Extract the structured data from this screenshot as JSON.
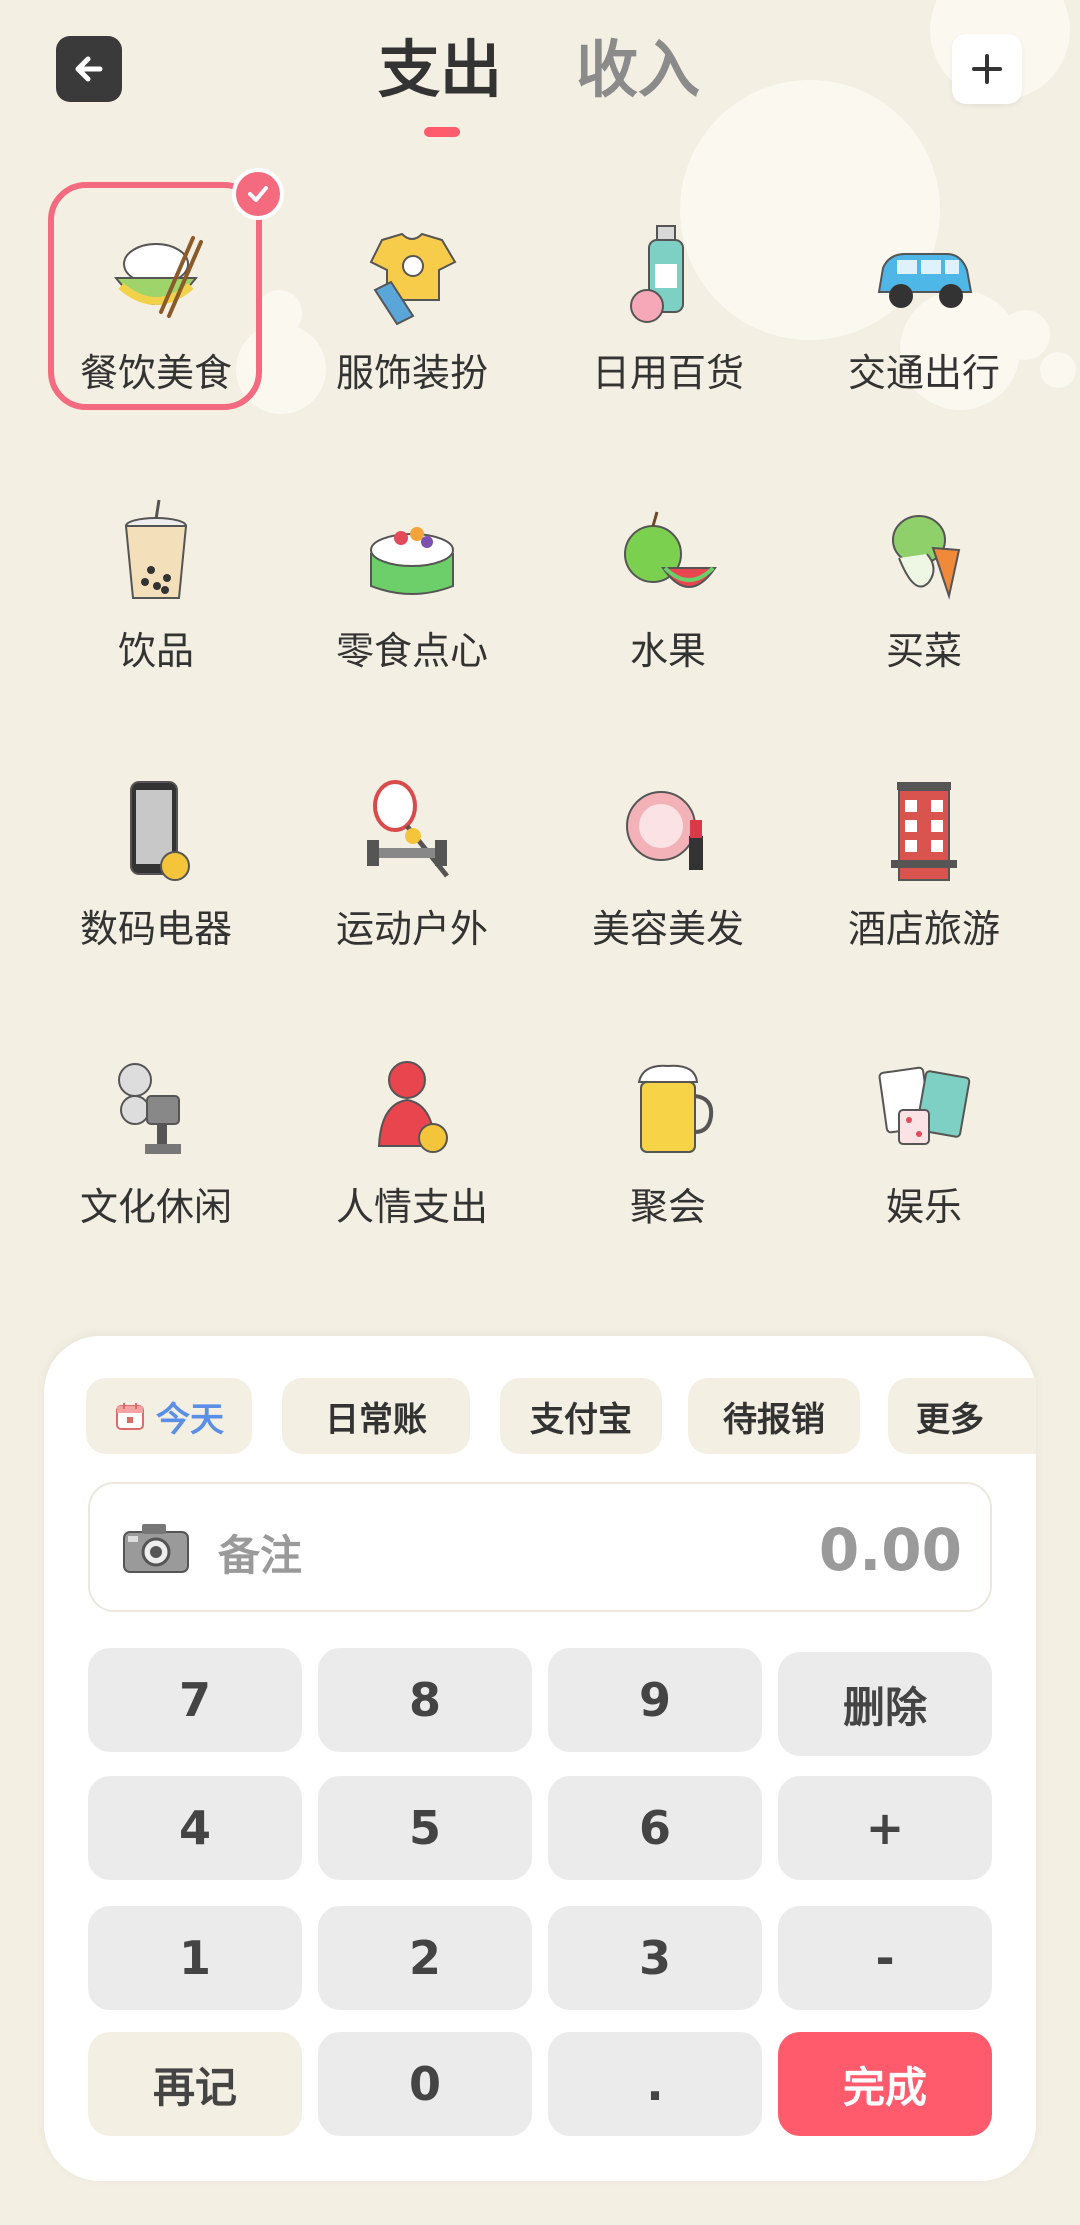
{
  "header": {
    "tabs": [
      {
        "label": "支出",
        "active": true
      },
      {
        "label": "收入",
        "active": false
      }
    ]
  },
  "categories": [
    {
      "label": "餐饮美食",
      "icon": "rice-bowl-icon",
      "selected": true
    },
    {
      "label": "服饰装扮",
      "icon": "tshirt-icon"
    },
    {
      "label": "日用百货",
      "icon": "lotion-bottle-icon"
    },
    {
      "label": "交通出行",
      "icon": "car-icon"
    },
    {
      "label": "饮品",
      "icon": "bubble-tea-icon"
    },
    {
      "label": "零食点心",
      "icon": "cake-icon"
    },
    {
      "label": "水果",
      "icon": "fruit-icon"
    },
    {
      "label": "买菜",
      "icon": "vegetable-icon"
    },
    {
      "label": "数码电器",
      "icon": "phone-icon"
    },
    {
      "label": "运动户外",
      "icon": "racket-icon"
    },
    {
      "label": "美容美发",
      "icon": "makeup-icon"
    },
    {
      "label": "酒店旅游",
      "icon": "hotel-icon"
    },
    {
      "label": "文化休闲",
      "icon": "film-projector-icon"
    },
    {
      "label": "人情支出",
      "icon": "person-money-icon"
    },
    {
      "label": "聚会",
      "icon": "beer-icon"
    },
    {
      "label": "娱乐",
      "icon": "playing-cards-icon"
    }
  ],
  "panel": {
    "chips": [
      "今天",
      "日常账",
      "支付宝",
      "待报销",
      "更多"
    ],
    "note_placeholder": "备注",
    "amount": "0.00",
    "keys": {
      "k7": "7",
      "k8": "8",
      "k9": "9",
      "delete": "删除",
      "k4": "4",
      "k5": "5",
      "k6": "6",
      "plus": "+",
      "k1": "1",
      "k2": "2",
      "k3": "3",
      "minus": "-",
      "again": "再记",
      "k0": "0",
      "dot": ".",
      "done": "完成"
    }
  },
  "colors": {
    "background": "#f3efe3",
    "accent": "#ff5b6c",
    "selected_border": "#f46a7e",
    "today_chip_text": "#5b8ee6"
  }
}
